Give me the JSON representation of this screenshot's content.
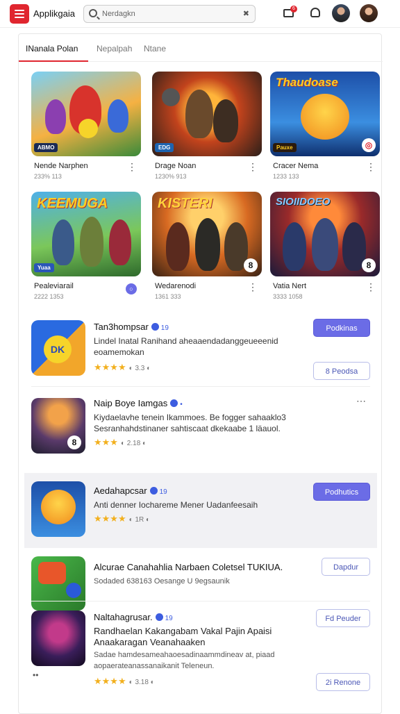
{
  "header": {
    "app_title": "Applikgaia",
    "search_placeholder": "Nerdagkn",
    "search_clear": "✖",
    "mail_badge": "6"
  },
  "tabs": [
    {
      "label": "INanala Polan",
      "active": true
    },
    {
      "label": "Nepalpah",
      "active": false
    },
    {
      "label": "Ntane",
      "active": false
    }
  ],
  "grid": [
    {
      "name": "Nende Narphen",
      "meta": "233% 113",
      "tag": "ABMO",
      "big": "",
      "corner": ""
    },
    {
      "name": "Drage Noan",
      "meta": "1230% 913",
      "tag": "EDG",
      "big": "",
      "corner": ""
    },
    {
      "name": "Cracer Nema",
      "meta": "1233 133",
      "tag": "Pauxe",
      "big": "Thaudoase",
      "corner": "◎"
    },
    {
      "name": "Pealeviarail",
      "meta": "2222 1353",
      "tag": "Yuaa",
      "big": "KEEMUGA",
      "corner": ""
    },
    {
      "name": "Wedarenodi",
      "meta": "1361 333",
      "tag": "",
      "big": "KISTERI",
      "corner": "8"
    },
    {
      "name": "Vatia Nert",
      "meta": "3333 1058",
      "tag": "",
      "big": "SIOIIDOEO",
      "corner": "8"
    }
  ],
  "list": [
    {
      "title": "Tan3hompsar",
      "vnum": "19",
      "desc": "Lindel Inatal Ranihand aheaaendadanggeueeenid eoamemokan",
      "stars": "★★★★",
      "count": "◐ 3.3 ◐",
      "btn1": "Podkinas",
      "btn2": "8 Peodsa"
    },
    {
      "title": "Naip Boye Iamgas",
      "vnum": "•",
      "desc": "Kiydaelavhe tenein Ikammoes. Be fogger sahaaklo3 Sesranhahdstinaner sahtiscaat dkekaabe 1 läauol.",
      "stars": "★★★",
      "count": "◐ 2.18 ◐",
      "btn1": "",
      "btn2": ""
    },
    {
      "title": "Aedahapcsar",
      "vnum": "19",
      "desc": "Anti denner Iochareme Mener Uadanfeesaih",
      "stars": "★★★★",
      "count": "◐ 1R ◐",
      "btn1": "Podhutics",
      "btn2": ""
    },
    {
      "title": "Alcurae Canahahlia Narbaen Coletsel TUKIUA.",
      "vnum": "",
      "desc": "Sodaded 638163 Oesange U 9egsaunik",
      "stars": "",
      "count": "",
      "btn1": "Dapdur",
      "btn2": ""
    },
    {
      "title": "Naltahagrusar.",
      "vnum": "19",
      "desc": "Randhaelan Kakangabam Vakal Pajin Apaisi Anaakaragan Veanahaaken",
      "desc2": "Sadae hamdesameahaoesadinaammdineav at, piaad aopaerateanassanaikanit Teleneun.",
      "stars": "★★★★",
      "count": "◐ 3.18 ◐",
      "btn1": "Fd Peuder",
      "btn2": "2i Renone"
    }
  ],
  "colors": {
    "accent": "#e0262f",
    "primary_button": "#6b6ce6",
    "star": "#f2b01e",
    "verified": "#3d5de0"
  }
}
